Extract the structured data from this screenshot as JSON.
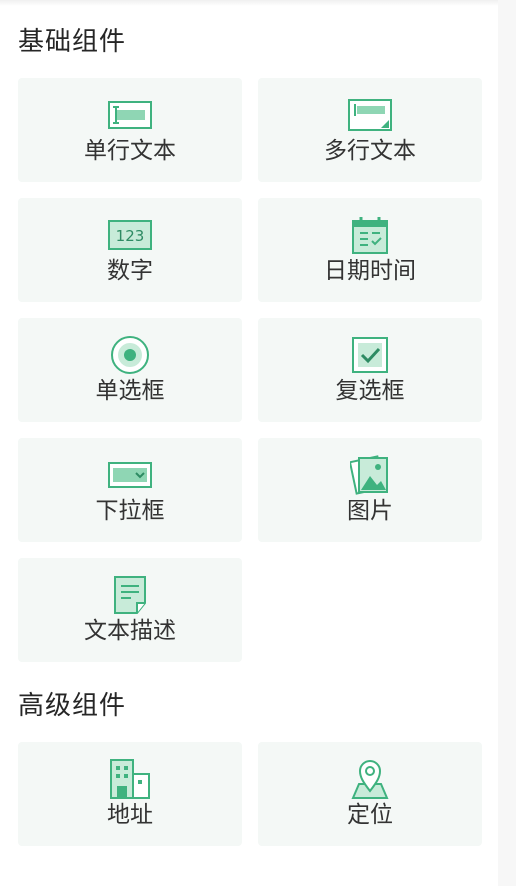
{
  "sections": {
    "basic": {
      "title": "基础组件",
      "items": [
        {
          "label": "单行文本",
          "icon": "single-line-text-icon"
        },
        {
          "label": "多行文本",
          "icon": "multi-line-text-icon"
        },
        {
          "label": "数字",
          "icon": "number-icon",
          "glyph": "123"
        },
        {
          "label": "日期时间",
          "icon": "calendar-icon"
        },
        {
          "label": "单选框",
          "icon": "radio-icon"
        },
        {
          "label": "复选框",
          "icon": "checkbox-icon"
        },
        {
          "label": "下拉框",
          "icon": "dropdown-icon"
        },
        {
          "label": "图片",
          "icon": "image-icon"
        },
        {
          "label": "文本描述",
          "icon": "text-description-icon"
        }
      ]
    },
    "advanced": {
      "title": "高级组件",
      "items": [
        {
          "label": "地址",
          "icon": "building-icon"
        },
        {
          "label": "定位",
          "icon": "location-pin-icon"
        }
      ]
    }
  },
  "colors": {
    "accent": "#3fb27f",
    "accent_light": "#c8ebd9",
    "tile_bg": "#f4f8f6",
    "text": "#333333"
  }
}
